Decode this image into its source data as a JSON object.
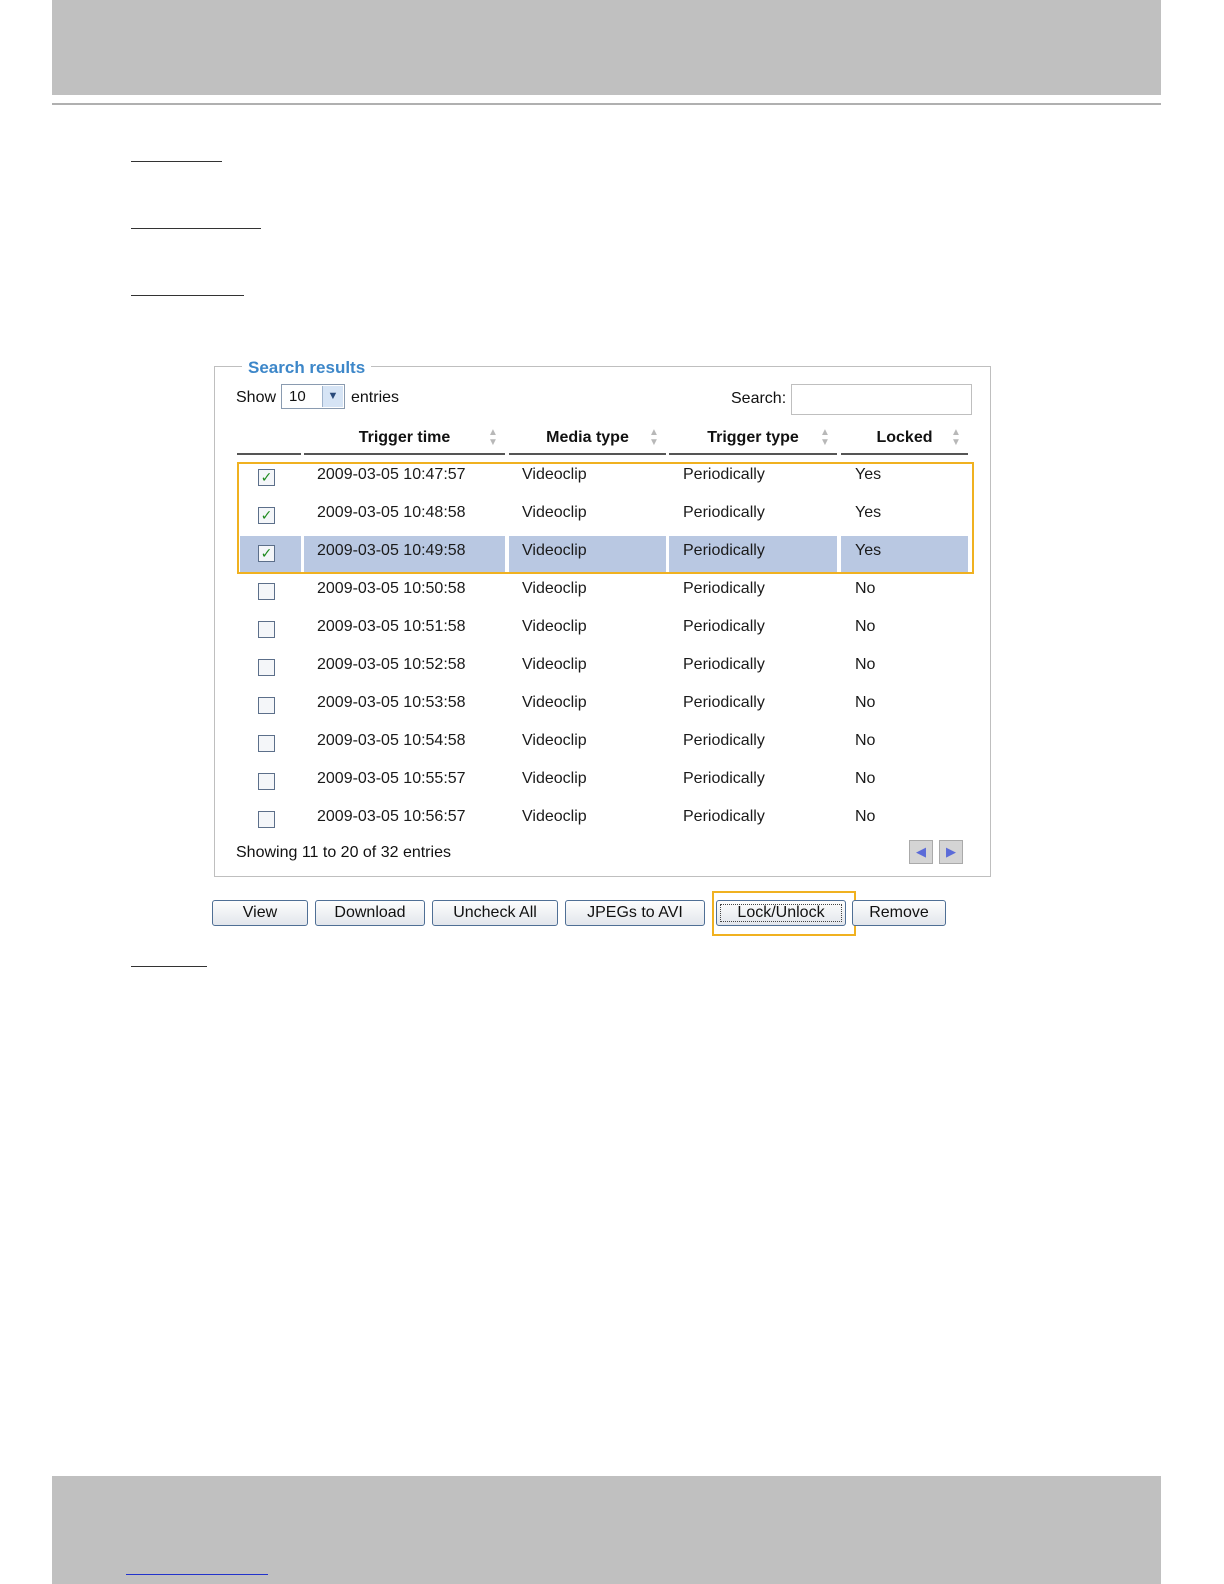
{
  "panel": {
    "title": "Search results",
    "show_label": "Show",
    "show_value": "10",
    "entries_label": "entries",
    "search_label": "Search:",
    "search_value": ""
  },
  "table": {
    "headers": [
      "Trigger time",
      "Media type",
      "Trigger type",
      "Locked"
    ],
    "rows": [
      {
        "checked": true,
        "selected": false,
        "time": "2009-03-05 10:47:57",
        "media": "Videoclip",
        "trigger": "Periodically",
        "locked": "Yes"
      },
      {
        "checked": true,
        "selected": false,
        "time": "2009-03-05 10:48:58",
        "media": "Videoclip",
        "trigger": "Periodically",
        "locked": "Yes"
      },
      {
        "checked": true,
        "selected": true,
        "time": "2009-03-05 10:49:58",
        "media": "Videoclip",
        "trigger": "Periodically",
        "locked": "Yes"
      },
      {
        "checked": false,
        "selected": false,
        "time": "2009-03-05 10:50:58",
        "media": "Videoclip",
        "trigger": "Periodically",
        "locked": "No"
      },
      {
        "checked": false,
        "selected": false,
        "time": "2009-03-05 10:51:58",
        "media": "Videoclip",
        "trigger": "Periodically",
        "locked": "No"
      },
      {
        "checked": false,
        "selected": false,
        "time": "2009-03-05 10:52:58",
        "media": "Videoclip",
        "trigger": "Periodically",
        "locked": "No"
      },
      {
        "checked": false,
        "selected": false,
        "time": "2009-03-05 10:53:58",
        "media": "Videoclip",
        "trigger": "Periodically",
        "locked": "No"
      },
      {
        "checked": false,
        "selected": false,
        "time": "2009-03-05 10:54:58",
        "media": "Videoclip",
        "trigger": "Periodically",
        "locked": "No"
      },
      {
        "checked": false,
        "selected": false,
        "time": "2009-03-05 10:55:57",
        "media": "Videoclip",
        "trigger": "Periodically",
        "locked": "No"
      },
      {
        "checked": false,
        "selected": false,
        "time": "2009-03-05 10:56:57",
        "media": "Videoclip",
        "trigger": "Periodically",
        "locked": "No"
      }
    ],
    "info": "Showing 11 to 20 of 32 entries"
  },
  "buttons": {
    "view": "View",
    "download": "Download",
    "uncheck_all": "Uncheck All",
    "jpegs_to_avi": "JPEGs to AVI",
    "lock_unlock": "Lock/Unlock",
    "remove": "Remove"
  },
  "icons": {
    "sort": "sort-both-icon",
    "checkbox_checked": "checkmark-icon",
    "dropdown": "chevron-down-icon",
    "prev": "triangle-left-icon",
    "next": "triangle-right-icon"
  },
  "colors": {
    "legend": "#3d87c9",
    "selected_row": "#b9c8e2",
    "highlight": "#f0b120",
    "band": "#c0c0c0"
  }
}
